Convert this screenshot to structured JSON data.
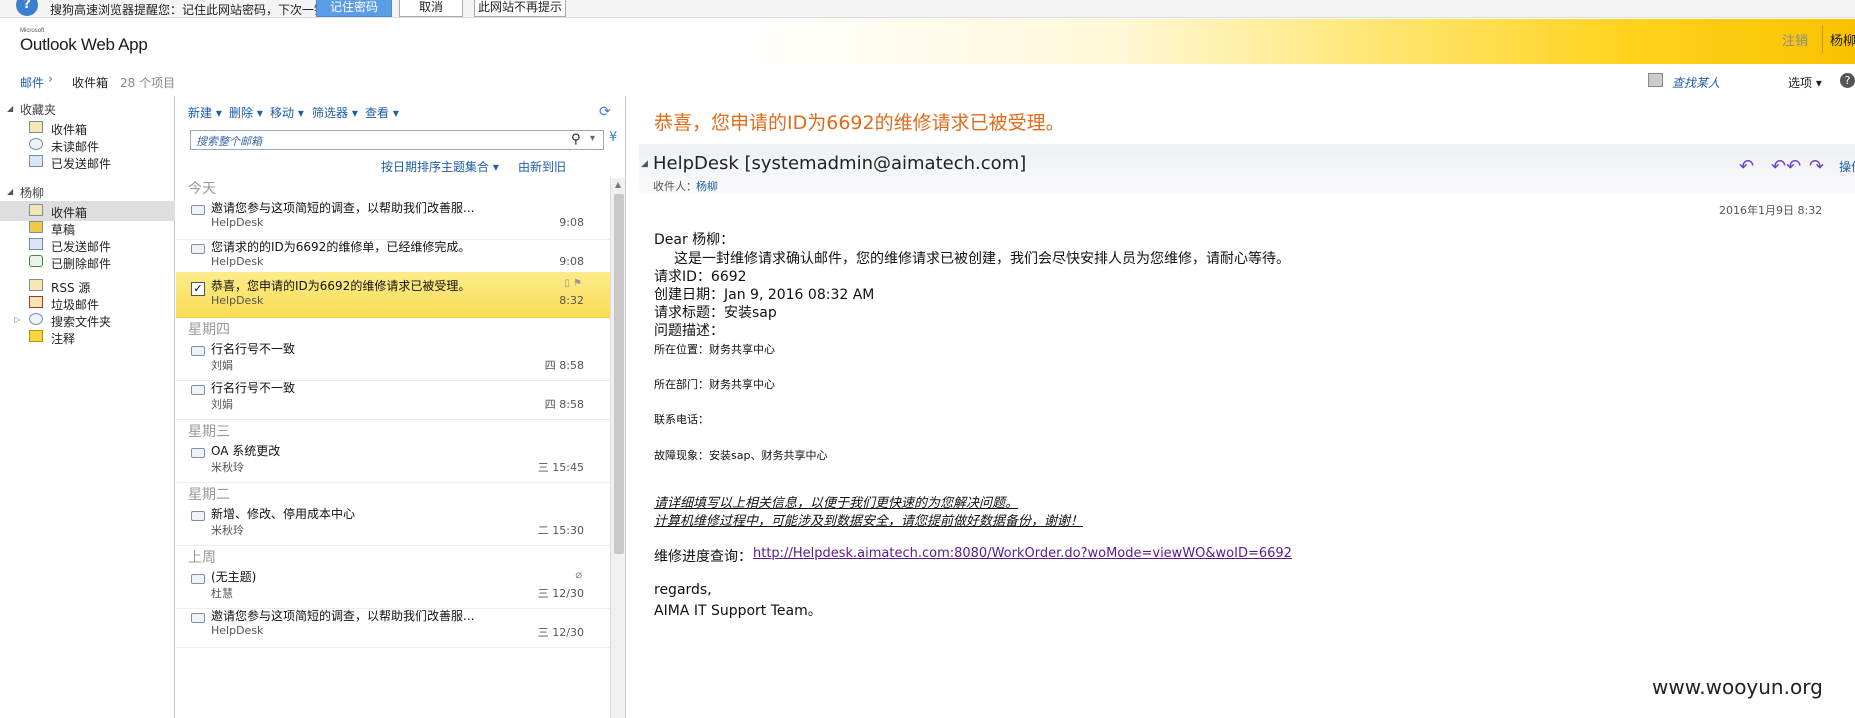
{
  "password_bar": {
    "message": "搜狗高速浏览器提醒您：记住此网站密码，下次一键登录！",
    "remember_label": "记住密码",
    "cancel_label": "取消",
    "never_label": "此网站不再提示"
  },
  "header": {
    "brand_small": "Microsoft",
    "app_title": "Outlook Web App",
    "signout_label": "注销",
    "user_name": "杨柳"
  },
  "breadcrumb": {
    "mail": "邮件",
    "inbox": "收件箱",
    "count": "28 个项目",
    "find_people": "查找某人",
    "options": "选项"
  },
  "folders": {
    "favorites_title": "收藏夹",
    "favorites": [
      "收件箱",
      "未读邮件",
      "已发送邮件"
    ],
    "mailbox_title": "杨柳",
    "mailbox": [
      "收件箱",
      "草稿",
      "已发送邮件",
      "已删除邮件",
      "RSS 源",
      "垃圾邮件",
      "搜索文件夹",
      "注释"
    ]
  },
  "toolbar": {
    "new_label": "新建",
    "delete_label": "删除",
    "move_label": "移动",
    "filter_label": "筛选器",
    "view_label": "查看"
  },
  "search": {
    "placeholder": "搜索整个邮箱"
  },
  "sort": {
    "sort_label": "按日期排序主题集合",
    "order_label": "由新到旧"
  },
  "groups": [
    "今天",
    "星期四",
    "星期三",
    "星期二",
    "上周"
  ],
  "messages": [
    {
      "subject": "邀请您参与这项简短的调查，以帮助我们改善服...",
      "from": "HelpDesk",
      "time": "9:08"
    },
    {
      "subject": "您请求的的ID为6692的维修单，已经维修完成。",
      "from": "HelpDesk",
      "time": "9:08"
    },
    {
      "subject": "恭喜，您申请的ID为6692的维修请求已被受理。",
      "from": "HelpDesk",
      "time": "8:32"
    },
    {
      "subject": "行名行号不一致",
      "from": "刘娟",
      "time": "四 8:58"
    },
    {
      "subject": "行名行号不一致",
      "from": "刘娟",
      "time": "四 8:58"
    },
    {
      "subject": "OA 系统更改",
      "from": "米秋玲",
      "time": "三 15:45"
    },
    {
      "subject": "新增、修改、停用成本中心",
      "from": "米秋玲",
      "time": "二 15:30"
    },
    {
      "subject": "(无主题)",
      "from": "杜慧",
      "time": "三 12/30"
    },
    {
      "subject": "邀请您参与这项简短的调查，以帮助我们改善服...",
      "from": "HelpDesk",
      "time": "三 12/30"
    }
  ],
  "reading": {
    "subject": "恭喜，您申请的ID为6692的维修请求已被受理。",
    "sender": "HelpDesk [systemadmin@aimatech.com]",
    "to_label": "收件人：",
    "to_name": "杨柳",
    "more_label": "操作",
    "date": "2016年1月9日 8:32",
    "body": {
      "greeting": "Dear 杨柳：",
      "intro": "这是一封维修请求确认邮件，您的维修请求已被创建，我们会尽快安排人员为您维修，请耐心等待。",
      "request_id": "请求ID：6692",
      "created": "创建日期：Jan 9, 2016 08:32 AM",
      "title": "请求标题：安装sap",
      "desc": "问题描述：",
      "location": "所在位置：财务共享中心",
      "dept": "所在部门：财务共享中心",
      "phone": "联系电话：",
      "symptom": "故障现象：安装sap、财务共享中心",
      "note1": "请详细填写以上相关信息，以便于我们更快速的为您解决问题。",
      "note2": "计算机维修过程中，可能涉及到数据安全，请您提前做好数据备份，谢谢！",
      "progress_label": "维修进度查询：",
      "progress_link": "http://Helpdesk.aimatech.com:8080/WorkOrder.do?woMode=viewWO&woID=6692",
      "regards": "regards,",
      "team": "AIMA IT Support Team。"
    }
  },
  "watermark": "www.wooyun.org",
  "colors": {
    "accent_link": "#1e5ea8",
    "subject_orange": "#e26b1a",
    "selected_row": "#fbe57c"
  }
}
